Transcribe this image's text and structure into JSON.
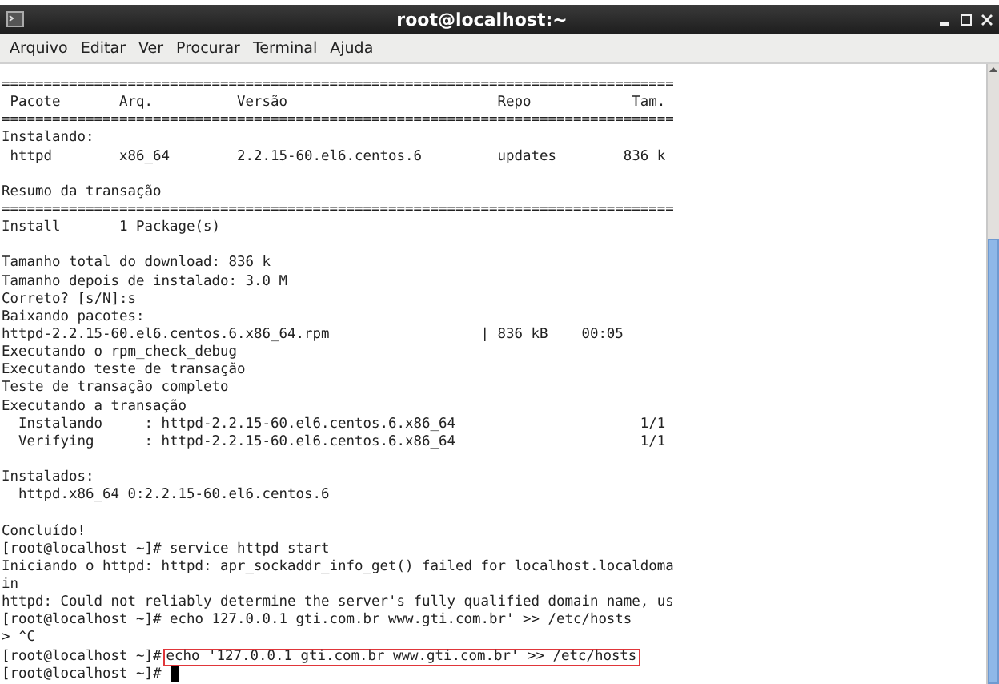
{
  "window": {
    "title": "root@localhost:~"
  },
  "menu": [
    "Arquivo",
    "Editar",
    "Ver",
    "Procurar",
    "Terminal",
    "Ajuda"
  ],
  "terminal": {
    "lines": [
      {
        "kind": "output",
        "text": "================================================================================"
      },
      {
        "kind": "output",
        "text": " Pacote       Arq.          Versão                         Repo            Tam."
      },
      {
        "kind": "output",
        "text": "================================================================================"
      },
      {
        "kind": "output",
        "text": "Instalando:"
      },
      {
        "kind": "output",
        "text": " httpd        x86_64        2.2.15-60.el6.centos.6         updates        836 k"
      },
      {
        "kind": "blank"
      },
      {
        "kind": "output",
        "text": "Resumo da transação"
      },
      {
        "kind": "output",
        "text": "================================================================================"
      },
      {
        "kind": "output",
        "text": "Install       1 Package(s)"
      },
      {
        "kind": "blank"
      },
      {
        "kind": "output",
        "text": "Tamanho total do download: 836 k"
      },
      {
        "kind": "output",
        "text": "Tamanho depois de instalado: 3.0 M"
      },
      {
        "kind": "output",
        "text": "Correto? [s/N]:s"
      },
      {
        "kind": "output",
        "text": "Baixando pacotes:"
      },
      {
        "kind": "output",
        "text": "httpd-2.2.15-60.el6.centos.6.x86_64.rpm                  | 836 kB    00:05"
      },
      {
        "kind": "output",
        "text": "Executando o rpm_check_debug"
      },
      {
        "kind": "output",
        "text": "Executando teste de transação"
      },
      {
        "kind": "output",
        "text": "Teste de transação completo"
      },
      {
        "kind": "output",
        "text": "Executando a transação"
      },
      {
        "kind": "output",
        "text": "  Instalando     : httpd-2.2.15-60.el6.centos.6.x86_64                      1/1"
      },
      {
        "kind": "output",
        "text": "  Verifying      : httpd-2.2.15-60.el6.centos.6.x86_64                      1/1"
      },
      {
        "kind": "blank"
      },
      {
        "kind": "output",
        "text": "Instalados:"
      },
      {
        "kind": "output",
        "text": "  httpd.x86_64 0:2.2.15-60.el6.centos.6"
      },
      {
        "kind": "blank"
      },
      {
        "kind": "output",
        "text": "Concluído!"
      },
      {
        "kind": "output",
        "text": "[root@localhost ~]# service httpd start"
      },
      {
        "kind": "output",
        "text": "Iniciando o httpd: httpd: apr_sockaddr_info_get() failed for localhost.localdoma"
      },
      {
        "kind": "output",
        "text": "in"
      },
      {
        "kind": "output",
        "text": "httpd: Could not reliably determine the server's fully qualified domain name, us"
      },
      {
        "kind": "output",
        "text": "[root@localhost ~]# echo 127.0.0.1 gti.com.br www.gti.com.br' >> /etc/hosts"
      },
      {
        "kind": "output",
        "text": "> ^C"
      },
      {
        "kind": "highlighted",
        "prompt": "[root@localhost ~]#",
        "command": "echo '127.0.0.1 gti.com.br www.gti.com.br' >> /etc/hosts"
      },
      {
        "kind": "cursor",
        "prompt": "[root@localhost ~]#"
      }
    ]
  }
}
